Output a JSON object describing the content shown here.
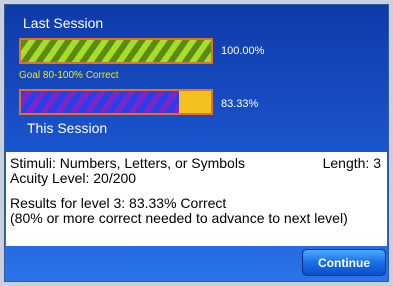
{
  "last_session": {
    "label": "Last Session",
    "percent_text": "100.00%",
    "value_fraction": 1.0
  },
  "goal": {
    "text": "Goal 80-100% Correct"
  },
  "this_session": {
    "label": "This Session",
    "percent_text": "83.33%",
    "value_fraction": 0.8333
  },
  "info": {
    "stimuli": "Stimuli:  Numbers, Letters, or Symbols",
    "length": "Length: 3",
    "acuity": "Acuity Level: 20/200",
    "results": "Results for level 3:  83.33% Correct",
    "advance_note": "(80% or more correct needed to advance to next level)"
  },
  "footer": {
    "continue_label": "Continue"
  },
  "colors": {
    "panel_blue": "#1b56cf",
    "goal_yellow": "#ffe600",
    "bar_border": "#e0702a",
    "bar_empty": "#f4c11e"
  }
}
